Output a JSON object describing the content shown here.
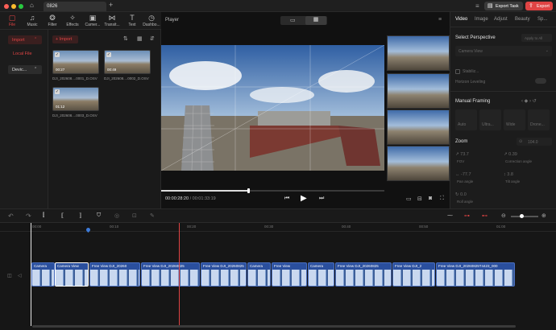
{
  "window": {
    "tab_title": "0826",
    "export_task": "Export Task",
    "export": "Export"
  },
  "toolbar": {
    "items": [
      "File",
      "Music",
      "Filter",
      "Effects",
      "Camer...",
      "Transit...",
      "Text",
      "Dashbo..."
    ]
  },
  "leftnav": {
    "import": "Import",
    "local_file": "Local File",
    "device": "Devic..."
  },
  "media": {
    "import_button": "Import",
    "items": [
      {
        "name": "DJI_202608....0001_D.OSV",
        "duration": "00:27"
      },
      {
        "name": "DJI_202608....0002_D.OSV",
        "duration": "00:49"
      },
      {
        "name": "DJI_202608....0003_D.OSV",
        "duration": "01:12"
      }
    ]
  },
  "player": {
    "title": "Player",
    "current_time": "00:00:28:20",
    "total_time": "00:01:33:19"
  },
  "right_panel": {
    "tabs": [
      "Video",
      "Image",
      "Adjust",
      "Beauty",
      "Sp..."
    ],
    "select_perspective": "Select Perspective",
    "apply_all": "Apply to All",
    "camera_view": "Camera View",
    "stabilize": "Stabiliz...",
    "horizon": "Horizon Leveling",
    "manual_framing": "Manual Framing",
    "framing_modes": [
      "Auto",
      "Ultra...",
      "Wide",
      "Drone..."
    ],
    "zoom": "Zoom",
    "zoom_value": "104.0",
    "params": [
      {
        "value": "73.7",
        "label": "FOV"
      },
      {
        "value": "0.39",
        "label": "Correction angle"
      },
      {
        "value": "-77.7",
        "label": "Pan angle"
      },
      {
        "value": "3.8",
        "label": "Tilt angle"
      },
      {
        "value": "0.0",
        "label": "Roll angle"
      }
    ]
  },
  "timeline": {
    "ruler": [
      "00:00",
      "00:10",
      "00:20",
      "00:30",
      "00:40",
      "00:50",
      "01:00"
    ],
    "clips": [
      {
        "label": "Camera"
      },
      {
        "label": "Camera View"
      },
      {
        "label": "Free View   DJI_20260"
      },
      {
        "label": "Free View   DJI_20260825"
      },
      {
        "label": "Free View   DJI_20260825"
      },
      {
        "label": "Camera"
      },
      {
        "label": "Free View"
      },
      {
        "label": "Camera"
      },
      {
        "label": "Free View   DJI_20260825"
      },
      {
        "label": "Free View   DJI_2"
      },
      {
        "label": "Free View   DJI_20260825T4423_000"
      }
    ]
  },
  "colors": {
    "accent": "#e04444",
    "clip": "#2a4f9e",
    "select": "#3d7bd9"
  }
}
